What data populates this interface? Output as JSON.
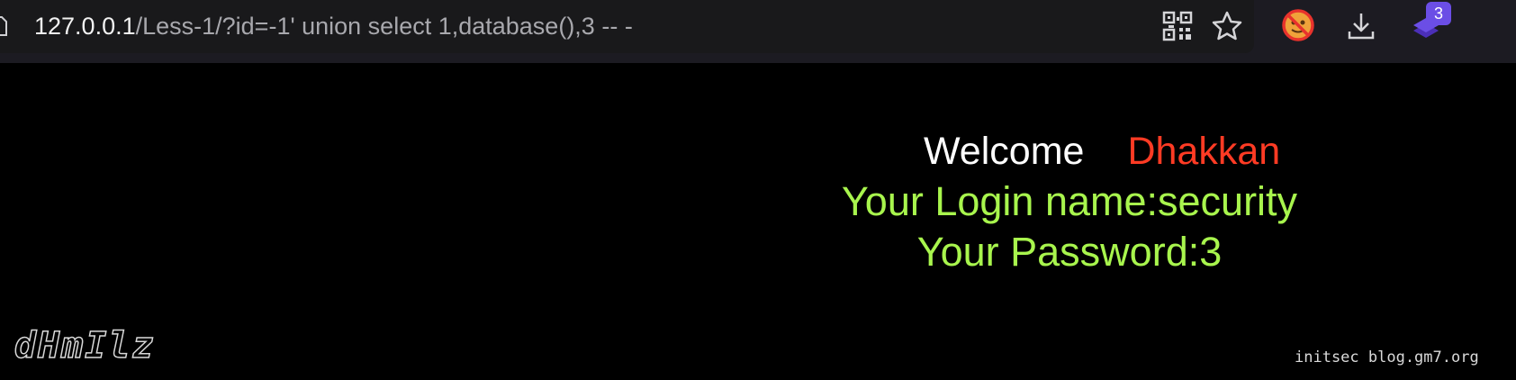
{
  "browser": {
    "url_host": "127.0.0.1",
    "url_path": "/Less-1/?id=-1' union select 1,database(),3 -- -",
    "icons": [
      "page-icon",
      "qr-code-icon",
      "bookmark-star-icon",
      "blocked-extension-icon",
      "download-icon",
      "extension-stack-icon"
    ],
    "extension_badge": "3",
    "badge_color": "#6b4ee6"
  },
  "page": {
    "welcome_word": "Welcome",
    "welcome_name": "Dhakkan",
    "login_text": "Your Login name:security",
    "password_text": "Your Password:3",
    "logo_text": "dHmIlz",
    "footer_credit": "initsec blog.gm7.org",
    "colors": {
      "background": "#000000",
      "welcome": "#ffffff",
      "name": "#ff3b24",
      "result": "#a8f54d"
    }
  }
}
